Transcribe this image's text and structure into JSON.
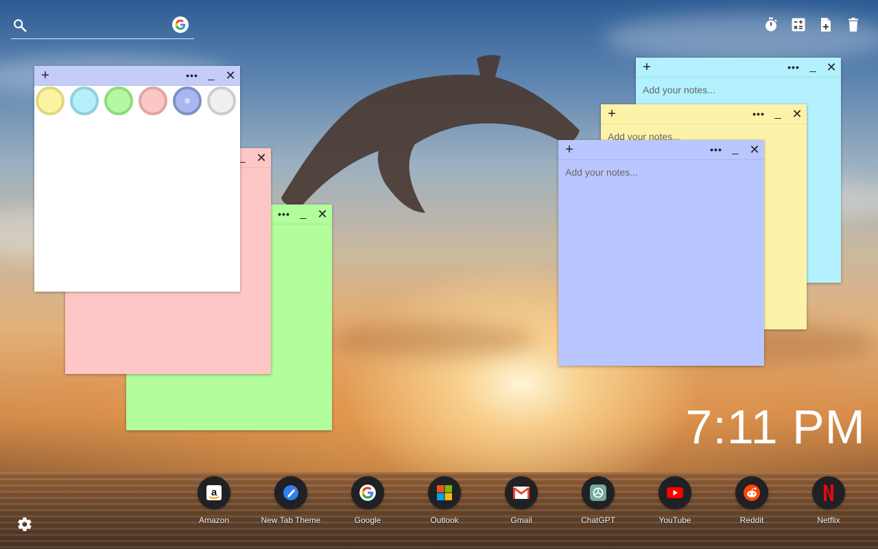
{
  "search": {
    "placeholder": ""
  },
  "top_icons": [
    "timer-icon",
    "calculator-icon",
    "new-note-icon",
    "trash-icon"
  ],
  "note_placeholder": "Add your notes...",
  "notes": {
    "white": {
      "color": "#ffffff"
    },
    "pink": {
      "color": "#ffc6c6"
    },
    "green": {
      "color": "#b2fd9c"
    },
    "cyan": {
      "color": "#b2f1fd"
    },
    "yellow": {
      "color": "#fdf3a8"
    },
    "blue": {
      "color": "#b9c6ff"
    }
  },
  "color_swatches": [
    {
      "name": "yellow",
      "fill": "#fbf3a2",
      "ring": "#e1d77a"
    },
    {
      "name": "cyan",
      "fill": "#b4effa",
      "ring": "#8fd0dc"
    },
    {
      "name": "green",
      "fill": "#b5f7a3",
      "ring": "#8edb7c"
    },
    {
      "name": "pink",
      "fill": "#fcc6c6",
      "ring": "#e0a5a5"
    },
    {
      "name": "blue",
      "fill": "#a9b6f0",
      "ring": "#8390c4"
    },
    {
      "name": "white",
      "fill": "#efefef",
      "ring": "#cccccc"
    }
  ],
  "clock": {
    "time": "7:11 PM"
  },
  "dock": [
    {
      "label": "Amazon",
      "icon": "amazon-icon"
    },
    {
      "label": "New Tab Theme",
      "icon": "new-tab-theme-icon"
    },
    {
      "label": "Google",
      "icon": "google-icon"
    },
    {
      "label": "Outlook",
      "icon": "outlook-icon"
    },
    {
      "label": "Gmail",
      "icon": "gmail-icon"
    },
    {
      "label": "ChatGPT",
      "icon": "chatgpt-icon"
    },
    {
      "label": "YouTube",
      "icon": "youtube-icon"
    },
    {
      "label": "Reddit",
      "icon": "reddit-icon"
    },
    {
      "label": "Netflix",
      "icon": "netflix-icon"
    }
  ]
}
